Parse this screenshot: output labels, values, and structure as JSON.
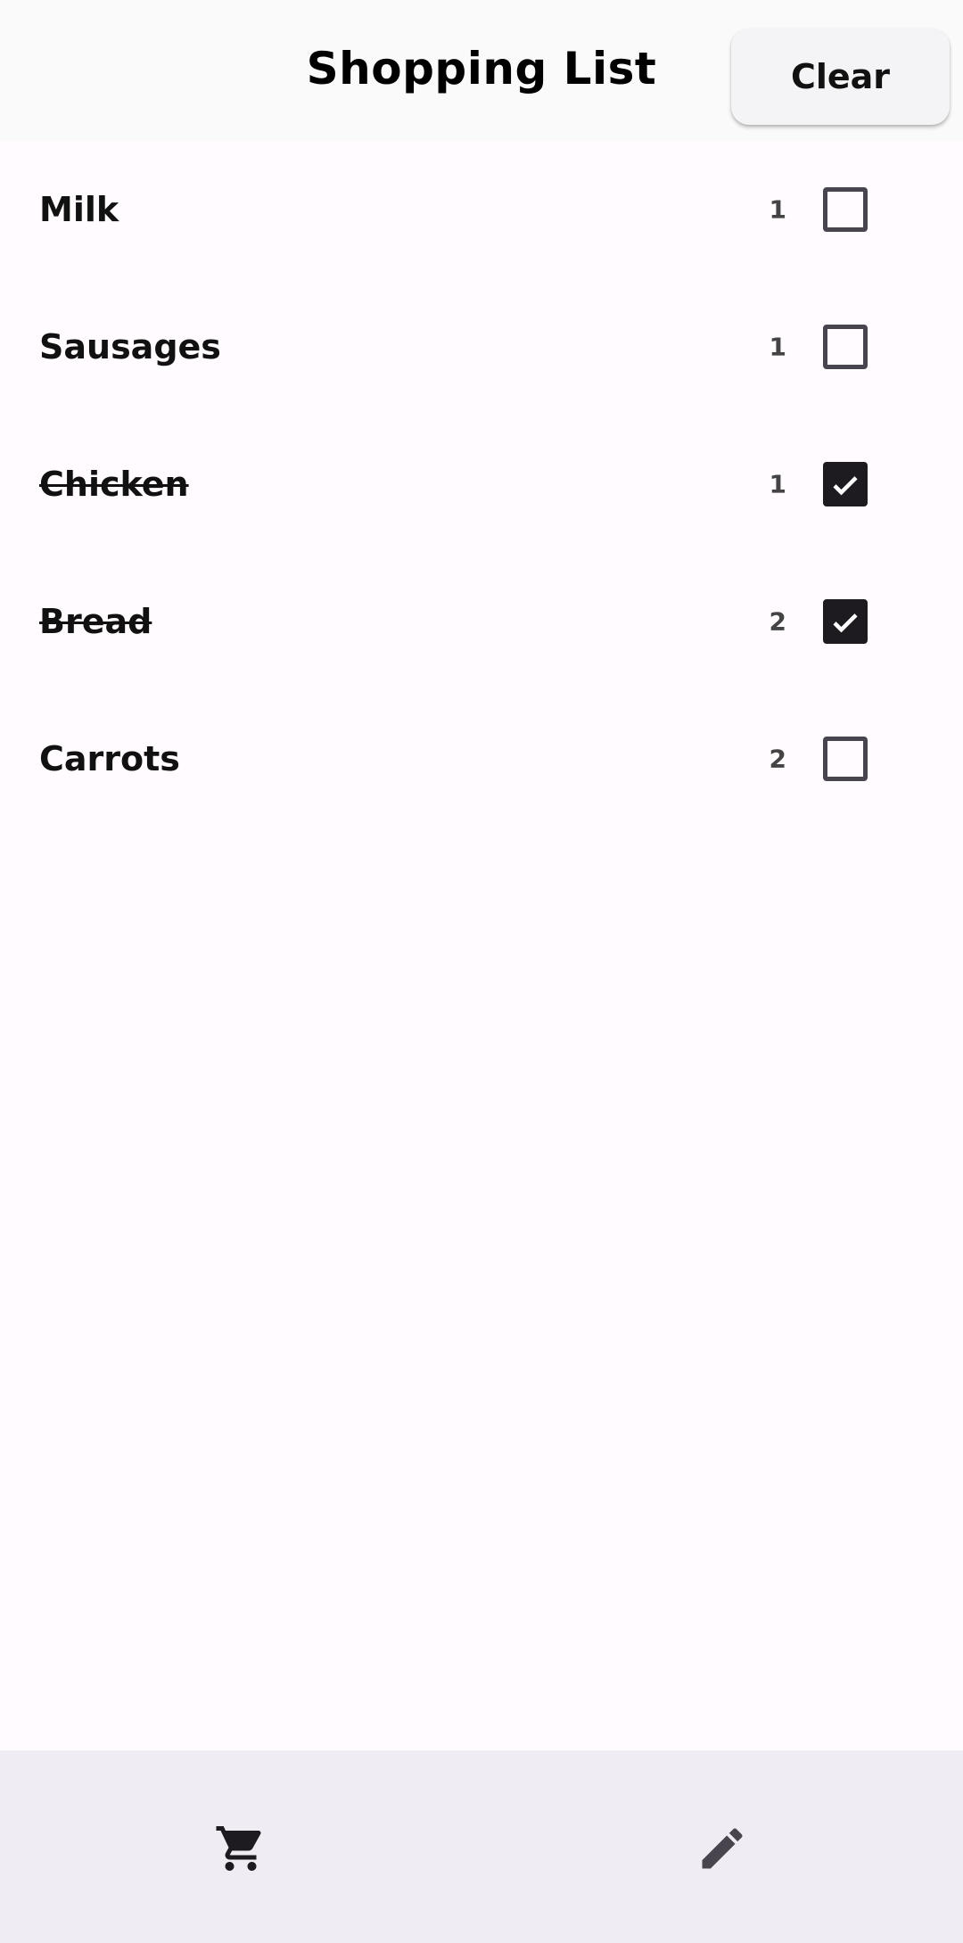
{
  "header": {
    "title": "Shopping List",
    "clear_label": "Clear"
  },
  "items": [
    {
      "name": "Milk",
      "quantity": "1",
      "checked": false
    },
    {
      "name": "Sausages",
      "quantity": "1",
      "checked": false
    },
    {
      "name": "Chicken",
      "quantity": "1",
      "checked": true
    },
    {
      "name": "Bread",
      "quantity": "2",
      "checked": true
    },
    {
      "name": "Carrots",
      "quantity": "2",
      "checked": false
    }
  ],
  "bottom_nav": {
    "items": [
      {
        "icon": "shopping-cart-icon",
        "active": true
      },
      {
        "icon": "pencil-icon",
        "active": false
      }
    ]
  },
  "colors": {
    "background": "#fffbfe",
    "header_bg": "#fafafa",
    "nav_bg": "#efedf3",
    "nav_active_pill": "#e8def8",
    "checkbox_checked": "#1d1b20"
  }
}
